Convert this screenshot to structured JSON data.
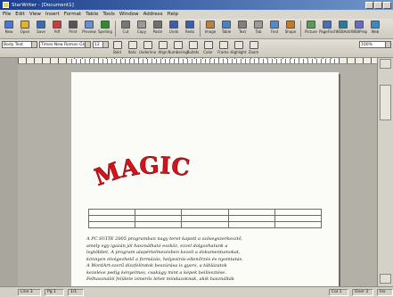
{
  "window": {
    "title": "StarWriter - [Document1]"
  },
  "menu": [
    "File",
    "Edit",
    "View",
    "Insert",
    "Format",
    "Table",
    "Tools",
    "Window",
    "Address",
    "Help"
  ],
  "toolbar1": [
    {
      "label": "New",
      "icon": "new-icon"
    },
    {
      "label": "Open",
      "icon": "open-icon"
    },
    {
      "label": "Save",
      "icon": "save-icon"
    },
    {
      "label": "Pdf",
      "icon": "pdf-icon"
    },
    {
      "label": "Print",
      "icon": "print-icon"
    },
    {
      "label": "Preview",
      "icon": "preview-icon"
    },
    {
      "label": "Spelling",
      "icon": "spelling-icon"
    },
    {
      "label": "Cut",
      "icon": "cut-icon"
    },
    {
      "label": "Copy",
      "icon": "copy-icon"
    },
    {
      "label": "Paste",
      "icon": "paste-icon"
    },
    {
      "label": "Undo",
      "icon": "undo-icon"
    },
    {
      "label": "Redo",
      "icon": "redo-icon"
    },
    {
      "label": "Image",
      "icon": "image-icon"
    },
    {
      "label": "Table",
      "icon": "table-icon"
    },
    {
      "label": "Text",
      "icon": "text-icon"
    },
    {
      "label": "Tab",
      "icon": "tab-icon"
    },
    {
      "label": "Find",
      "icon": "find-icon"
    },
    {
      "label": "Shape",
      "icon": "shape-icon"
    },
    {
      "label": "Picture",
      "icon": "picture-icon"
    },
    {
      "label": "PageFind",
      "icon": "pagefind-icon"
    },
    {
      "label": "WEBAdd",
      "icon": "webadd-icon"
    },
    {
      "label": "WEBPrep",
      "icon": "webprep-icon"
    },
    {
      "label": "Web",
      "icon": "web-icon"
    }
  ],
  "toolbar2": {
    "style": "Body Text",
    "font": "Times New Roman Gly",
    "size": "12",
    "buttons": [
      {
        "label": "Bold",
        "icon": "bold-icon"
      },
      {
        "label": "Italic",
        "icon": "italic-icon"
      },
      {
        "label": "Underline",
        "icon": "underline-icon"
      },
      {
        "label": "Align",
        "icon": "align-icon"
      },
      {
        "label": "Numbering",
        "icon": "numbering-icon"
      },
      {
        "label": "Bullets",
        "icon": "bullets-icon"
      },
      {
        "label": "Color",
        "icon": "color-icon"
      },
      {
        "label": "Frame",
        "icon": "frame-icon"
      },
      {
        "label": "Highlight",
        "icon": "highlight-icon"
      },
      {
        "label": "Zoom",
        "icon": "zoom-icon"
      }
    ],
    "zoom": "100%"
  },
  "document": {
    "wordart": "MAGIC",
    "wordart_color": "#d4141c",
    "table": {
      "rows": 3,
      "cols": 5
    },
    "body_lines": [
      "A PC SUITE 2005 programban nagy teret kapott a szövegszerkesztő,",
      "amely egy igazán jól használható eszköz, ezzel dolgozhatunk a",
      "legtöbbet. A program alapértelmezésben kezeli a dokumentumokat,",
      "könnyen elvégezhető a formázás, helyesírás-ellenőrzés és nyomtatás.",
      "A WordArt-szerű díszfeliratok beszúrása is gyors, a táblázatok",
      "kezelése pedig kényelmes, csakúgy mint a képek beillesztése.",
      "Felhasználói felülete ismerős lehet mindazoknak, akik használták"
    ]
  },
  "status": [
    "Line 3",
    "Pg 1",
    "1/1",
    "Col 1",
    "Over 3",
    "Ins"
  ]
}
